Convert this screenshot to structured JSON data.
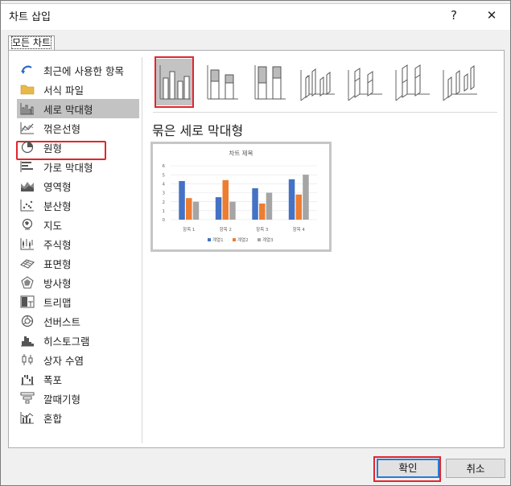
{
  "dialog": {
    "title": "차트 삽입",
    "help": "?",
    "close": "✕"
  },
  "tab": {
    "label": "모든 차트"
  },
  "categories": [
    {
      "label": "최근에 사용한 항목",
      "icon": "recent-icon"
    },
    {
      "label": "서식 파일",
      "icon": "folder-icon"
    },
    {
      "label": "세로 막대형",
      "icon": "column-chart-icon",
      "selected": true
    },
    {
      "label": "꺾은선형",
      "icon": "line-chart-icon"
    },
    {
      "label": "원형",
      "icon": "pie-chart-icon"
    },
    {
      "label": "가로 막대형",
      "icon": "bar-chart-icon"
    },
    {
      "label": "영역형",
      "icon": "area-chart-icon"
    },
    {
      "label": "분산형",
      "icon": "scatter-chart-icon"
    },
    {
      "label": "지도",
      "icon": "map-chart-icon"
    },
    {
      "label": "주식형",
      "icon": "stock-chart-icon"
    },
    {
      "label": "표면형",
      "icon": "surface-chart-icon"
    },
    {
      "label": "방사형",
      "icon": "radar-chart-icon"
    },
    {
      "label": "트리맵",
      "icon": "treemap-chart-icon"
    },
    {
      "label": "선버스트",
      "icon": "sunburst-chart-icon"
    },
    {
      "label": "히스토그램",
      "icon": "histogram-chart-icon"
    },
    {
      "label": "상자 수염",
      "icon": "box-whisker-chart-icon"
    },
    {
      "label": "폭포",
      "icon": "waterfall-chart-icon"
    },
    {
      "label": "깔때기형",
      "icon": "funnel-chart-icon"
    },
    {
      "label": "혼합",
      "icon": "combo-chart-icon"
    }
  ],
  "subtypes": [
    {
      "name": "clustered-column-icon",
      "selected": true
    },
    {
      "name": "stacked-column-icon"
    },
    {
      "name": "100-stacked-column-icon"
    },
    {
      "name": "3d-clustered-column-icon"
    },
    {
      "name": "3d-stacked-column-icon"
    },
    {
      "name": "3d-100-stacked-column-icon"
    },
    {
      "name": "3d-column-icon"
    }
  ],
  "selected_subtype_title": "묶은 세로 막대형",
  "chart_data": {
    "type": "bar",
    "title": "차트 제목",
    "categories": [
      "항목 1",
      "항목 2",
      "항목 3",
      "항목 4"
    ],
    "series": [
      {
        "name": "계열1",
        "values": [
          4.3,
          2.5,
          3.5,
          4.5
        ],
        "color": "#4472c4"
      },
      {
        "name": "계열2",
        "values": [
          2.4,
          4.4,
          1.8,
          2.8
        ],
        "color": "#ed7d31"
      },
      {
        "name": "계열3",
        "values": [
          2,
          2,
          3,
          5
        ],
        "color": "#a5a5a5"
      }
    ],
    "yticks": [
      "0",
      "1",
      "2",
      "3",
      "4",
      "5",
      "6"
    ],
    "ylim": [
      0,
      6
    ],
    "grid": true,
    "legend": "bottom"
  },
  "buttons": {
    "ok": "확인",
    "cancel": "취소"
  }
}
